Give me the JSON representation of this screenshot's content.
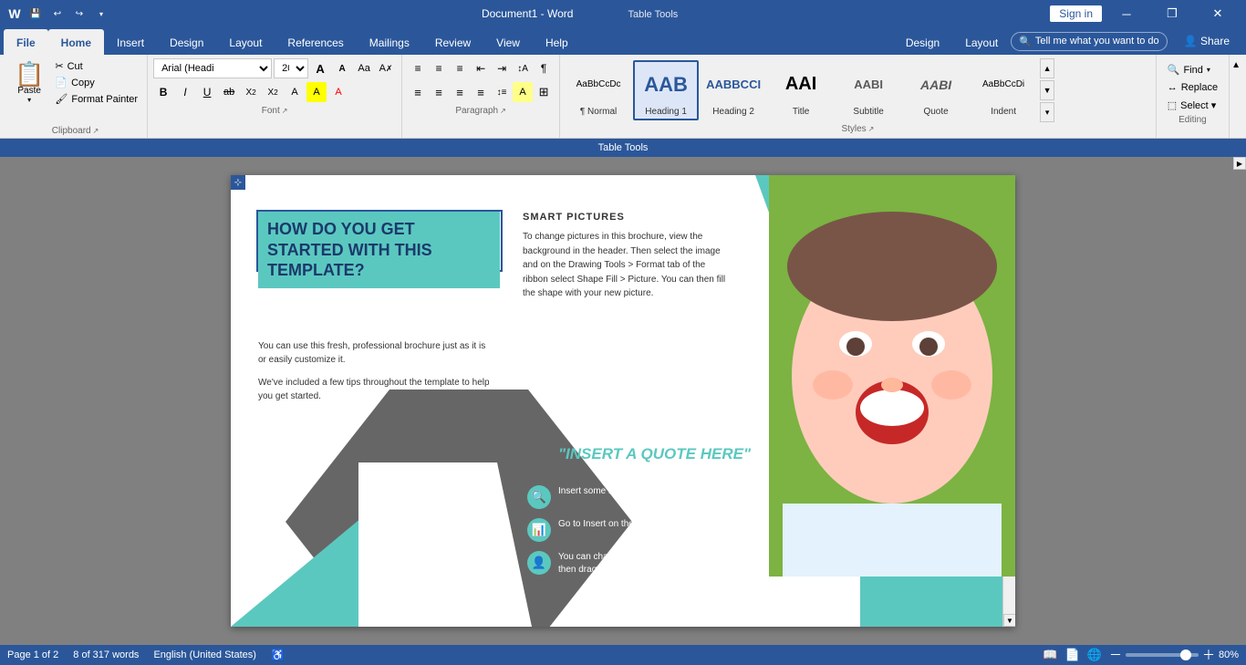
{
  "titlebar": {
    "title": "Document1 - Word",
    "table_tools": "Table Tools",
    "sign_in": "Sign in",
    "minimize": "─",
    "restore": "❐",
    "close": "✕"
  },
  "quickaccess": {
    "save": "💾",
    "undo": "↩",
    "redo": "↪",
    "more": "▾"
  },
  "tabs": [
    {
      "id": "file",
      "label": "File"
    },
    {
      "id": "home",
      "label": "Home",
      "active": true
    },
    {
      "id": "insert",
      "label": "Insert"
    },
    {
      "id": "design",
      "label": "Design"
    },
    {
      "id": "layout",
      "label": "Layout"
    },
    {
      "id": "references",
      "label": "References"
    },
    {
      "id": "mailings",
      "label": "Mailings"
    },
    {
      "id": "review",
      "label": "Review"
    },
    {
      "id": "view",
      "label": "View"
    },
    {
      "id": "help",
      "label": "Help"
    },
    {
      "id": "design2",
      "label": "Design"
    },
    {
      "id": "layout2",
      "label": "Layout"
    }
  ],
  "tell_me": "Tell me what you want to do",
  "share": "Share",
  "ribbon": {
    "clipboard": {
      "label": "Clipboard",
      "paste": "Paste",
      "cut": "Cut",
      "copy": "Copy",
      "format_painter": "Format Painter"
    },
    "font": {
      "label": "Font",
      "font_name": "Arial (Headi",
      "font_size": "20",
      "grow": "A",
      "shrink": "A",
      "change_case": "Aa",
      "clear_format": "✗",
      "bold": "B",
      "italic": "I",
      "underline": "U",
      "strikethrough": "ab",
      "subscript": "X",
      "superscript": "X",
      "text_color": "A",
      "highlight": "A"
    },
    "paragraph": {
      "label": "Paragraph",
      "bullets": "≡",
      "numbering": "≡",
      "multi_level": "≡",
      "decrease_indent": "⇤",
      "increase_indent": "⇥",
      "sort": "↕",
      "show_hide": "¶",
      "align_left": "≡",
      "align_center": "≡",
      "align_right": "≡",
      "justify": "≡",
      "line_spacing": "≡",
      "shading": "A",
      "borders": "⊞"
    },
    "styles": {
      "label": "Styles",
      "items": [
        {
          "id": "normal",
          "label": "¶ Normal",
          "preview": "AaBbCcDc",
          "style": "font-size:11px;"
        },
        {
          "id": "heading1",
          "label": "Heading 1",
          "preview": "AAB",
          "style": "font-size:20px;font-weight:bold;color:#2b579a;",
          "active": true
        },
        {
          "id": "heading2",
          "label": "Heading 2",
          "preview": "AABBCCI",
          "style": "font-size:13px;font-weight:bold;color:#2b579a;"
        },
        {
          "id": "title",
          "label": "Title",
          "preview": "AAI",
          "style": "font-size:18px;font-weight:bold;"
        },
        {
          "id": "subtitle",
          "label": "Subtitle",
          "preview": "AABI",
          "style": "font-size:13px;color:#666;"
        },
        {
          "id": "quote",
          "label": "Quote",
          "preview": "AABI",
          "style": "font-size:12px;font-style:italic;color:#666;"
        },
        {
          "id": "indent",
          "label": "Indent",
          "preview": "AaBbCcDi",
          "style": "font-size:11px;"
        }
      ]
    },
    "editing": {
      "label": "Editing",
      "find": "Find",
      "replace": "Replace",
      "select": "Select ▾"
    }
  },
  "table_tools": "Table Tools",
  "document": {
    "heading": "HOW DO YOU GET STARTED WITH THIS TEMPLATE?",
    "body1": "You can use this fresh, professional brochure just as it is or easily customize it.",
    "body2": "We've included a few tips throughout the template to help you get started.",
    "smart_title": "SMART PICTURES",
    "smart_body": "To change pictures in this brochure, view the background in the header. Then select the image and on the Drawing Tools > Format tab of the ribbon select Shape Fill > Picture. You can then fill the shape with your new picture.",
    "quote": "\"INSERT A QUOTE HERE\"",
    "icon_items": [
      {
        "text": "Insert some icons here to make your point."
      },
      {
        "text": "Go to Insert on the ribbon and select Icons."
      },
      {
        "text": "You can change the color of the icon to suit, then drag and drop it in place."
      }
    ]
  },
  "status": {
    "page": "Page 1 of 2",
    "words": "8 of 317 words",
    "language": "English (United States)",
    "zoom": "80%"
  }
}
